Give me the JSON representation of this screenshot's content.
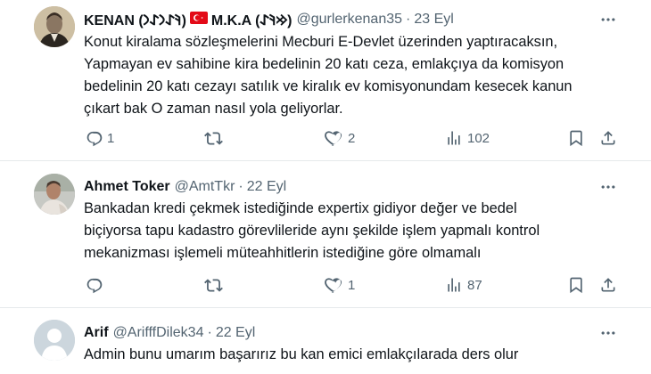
{
  "tweets": [
    {
      "name": "KENAN (𐰚𐰀𐰣𐰀𐰣)",
      "name2": "M.K.A (𐰢𐰚𐰀)",
      "handle": "@gurlerkenan35",
      "separator": "·",
      "date": "23 Eyl",
      "text_lines": [
        "Konut kiralama sözleşmelerini Mecburi E-Devlet üzerinden yaptıracaksın,",
        "Yapmayan ev sahibine kira bedelinin 20 katı ceza, emlakçıya da komisyon",
        "bedelinin 20 katı cezayı satılık ve kiralık ev komisyonundam kesecek kanun",
        "çıkart bak O zaman nasıl yola geliyorlar."
      ],
      "replies": "1",
      "retweets": "",
      "likes": "2",
      "views": "102"
    },
    {
      "name": "Ahmet Toker",
      "handle": "@AmtTkr",
      "separator": "·",
      "date": "22 Eyl",
      "text_lines": [
        "Bankadan kredi çekmek istediğinde expertix gidiyor değer ve bedel",
        "biçiyorsa tapu kadastro görevlileride aynı şekilde işlem yapmalı kontrol",
        "mekanizması işlemeli müteahhitlerin istediğine göre olmamalı"
      ],
      "replies": "",
      "retweets": "",
      "likes": "1",
      "views": "87"
    },
    {
      "name": "Arif",
      "handle": "@ArifffDilek34",
      "separator": "·",
      "date": "22 Eyl",
      "text_lines": [
        "Admin bunu umarım başarırız bu kan emici emlakçılarada ders olur"
      ]
    }
  ],
  "colors": {
    "text": "#0f1419",
    "secondary": "#536471",
    "divider": "#e6e9eb",
    "flag_red": "#e30a17"
  },
  "icons": [
    "more-icon",
    "reply-icon",
    "retweet-icon",
    "like-icon",
    "views-icon",
    "bookmark-icon",
    "share-icon",
    "turkish-flag-icon"
  ]
}
